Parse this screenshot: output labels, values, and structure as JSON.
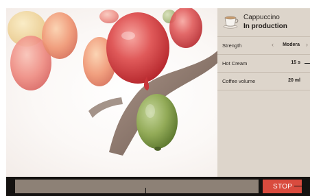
{
  "colors": {
    "panel_bg": "#ddd5cb",
    "stop_bg": "#d94b3e",
    "progress_bg": "#8d8176",
    "bottom_bar_bg": "#141210"
  },
  "drink": {
    "icon": "coffee-cup-icon",
    "name": "Cappuccino",
    "status": "In production"
  },
  "settings": [
    {
      "label": "Strength",
      "value": "Modera",
      "has_arrows": true
    },
    {
      "label": "Hot Cream",
      "value": "15 s"
    },
    {
      "label": "Coffee volume",
      "value": "20 ml"
    }
  ],
  "controls": {
    "prev_icon": "chevron-left-icon",
    "next_icon": "chevron-right-icon",
    "stop_label": "STOP"
  },
  "progress": {
    "fraction": 0.54
  }
}
